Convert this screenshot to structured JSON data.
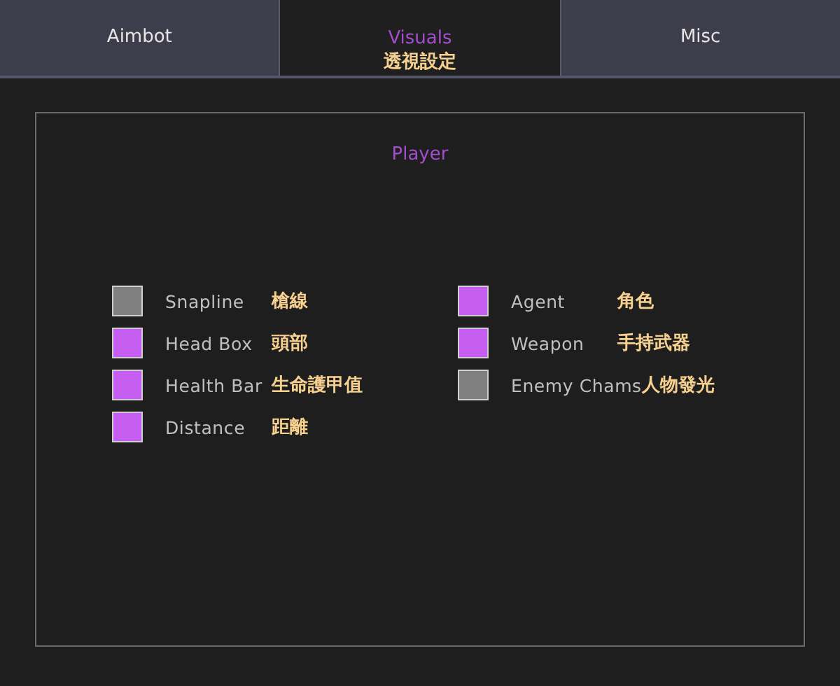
{
  "tabs": [
    {
      "label": "Aimbot",
      "selected": false
    },
    {
      "label": "Visuals",
      "note": "透視設定",
      "selected": true
    },
    {
      "label": "Misc",
      "selected": false
    }
  ],
  "panel": {
    "title": "Player",
    "columns": [
      [
        {
          "label": "Snapline",
          "note": "槍線",
          "checked": false
        },
        {
          "label": "Head Box",
          "note": "頭部",
          "checked": true
        },
        {
          "label": "Health Bar",
          "note": "生命護甲值",
          "checked": true
        },
        {
          "label": "Distance",
          "note": "距離",
          "checked": true
        }
      ],
      [
        {
          "label": "Agent",
          "note": "角色",
          "checked": true
        },
        {
          "label": "Weapon",
          "note": "手持武器",
          "checked": true
        },
        {
          "label": "Enemy Chams",
          "note": "人物發光",
          "checked": false
        }
      ]
    ]
  }
}
